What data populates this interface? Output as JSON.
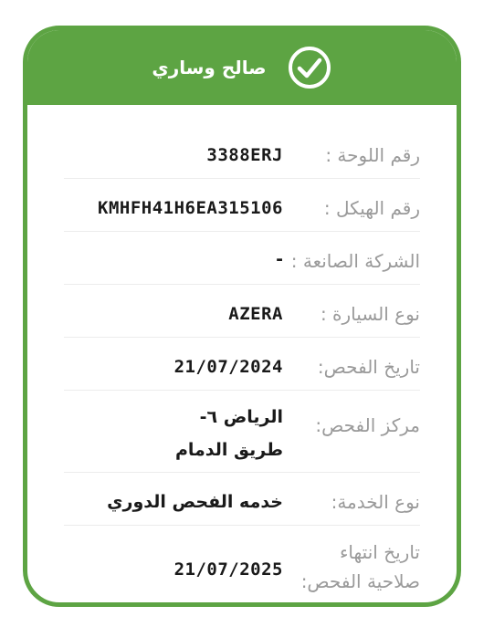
{
  "header": {
    "owner_name": "صالح وساري",
    "accent_color": "#5da443",
    "icon": "check-circle-icon"
  },
  "fields": [
    {
      "label": "رقم اللوحة :",
      "value": "3388ERJ"
    },
    {
      "label": "رقم الهيكل :",
      "value": "KMHFH41H6EA315106"
    },
    {
      "label": "الشركة الصانعة :",
      "value": "-"
    },
    {
      "label": "نوع السيارة :",
      "value": "AZERA"
    },
    {
      "label": "تاريخ الفحص:",
      "value": "21/07/2024"
    },
    {
      "label": "مركز الفحص:",
      "value": "الرياض ٦- طريق الدمام"
    },
    {
      "label": "نوع الخدمة:",
      "value": "خدمه الفحص الدوري"
    },
    {
      "label": "تاريخ انتهاء صلاحية الفحص:",
      "value": "21/07/2025"
    }
  ]
}
